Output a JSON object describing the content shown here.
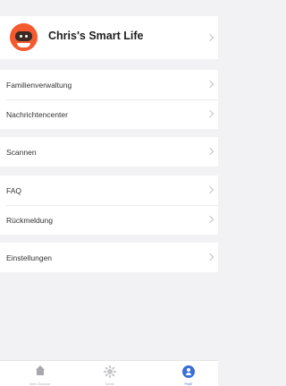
{
  "profile": {
    "name": "Chris's Smart Life",
    "avatar_icon": "robot-avatar-icon"
  },
  "groups": [
    {
      "items": [
        {
          "label": "Familienverwaltung"
        },
        {
          "label": "Nachrichtencenter"
        }
      ]
    },
    {
      "items": [
        {
          "label": "Scannen"
        }
      ]
    },
    {
      "items": [
        {
          "label": "FAQ"
        },
        {
          "label": "Rückmeldung"
        }
      ]
    },
    {
      "items": [
        {
          "label": "Einstellungen"
        }
      ]
    }
  ],
  "tabbar": {
    "tabs": [
      {
        "label": "Mein Zuhause",
        "icon": "home-icon"
      },
      {
        "label": "Szene",
        "icon": "sun-icon"
      },
      {
        "label": "Profil",
        "icon": "profile-icon",
        "active": true
      }
    ]
  },
  "colors": {
    "accent": "#3a6fd8",
    "avatar": "#f35a2f",
    "background": "#f2f2f4"
  }
}
